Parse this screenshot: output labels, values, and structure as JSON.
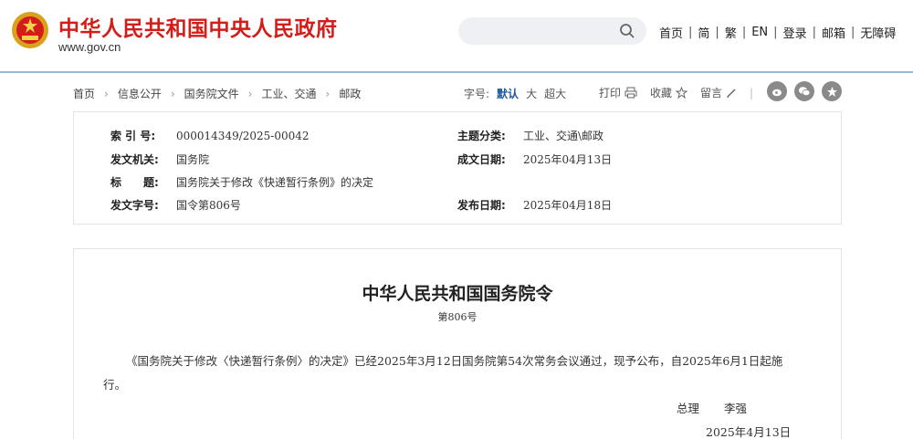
{
  "header": {
    "site_title": "中华人民共和国中央人民政府",
    "site_url": "www.gov.cn",
    "search": {
      "placeholder": ""
    },
    "nav": [
      "首页",
      "简",
      "繁",
      "EN",
      "登录",
      "邮箱",
      "无障碍"
    ],
    "colors": {
      "title_red": "#d41d18",
      "rule_blue": "#9fb6d3"
    }
  },
  "breadcrumb": [
    "首页",
    "信息公开",
    "国务院文件",
    "工业、交通",
    "邮政"
  ],
  "font_size": {
    "label": "字号:",
    "options": [
      "默认",
      "大",
      "超大"
    ],
    "selected": "默认"
  },
  "tools": {
    "print": "打印",
    "favorite": "收藏",
    "comment": "留言"
  },
  "share_icons": [
    "weibo-icon",
    "wechat-icon",
    "star-icon"
  ],
  "meta": {
    "index_label": "索 引 号:",
    "index_value": "000014349/2025-00042",
    "topic_label": "主题分类:",
    "topic_value": "工业、交通\\邮政",
    "issuer_label": "发文机关:",
    "issuer_value": "国务院",
    "written_label": "成文日期:",
    "written_value": "2025年04月13日",
    "title_label": "标　　题:",
    "title_value": "国务院关于修改《快递暂行条例》的决定",
    "docno_label": "发文字号:",
    "docno_value": "国令第806号",
    "published_label": "发布日期:",
    "published_value": "2025年04月18日"
  },
  "article": {
    "title": "中华人民共和国国务院令",
    "number": "第806号",
    "body": "《国务院关于修改〈快递暂行条例〉的决定》已经2025年3月12日国务院第54次常务会议通过，现予公布，自2025年6月1日起施行。",
    "sign_title": "总理",
    "sign_name": "李强",
    "sign_date": "2025年4月13日"
  }
}
